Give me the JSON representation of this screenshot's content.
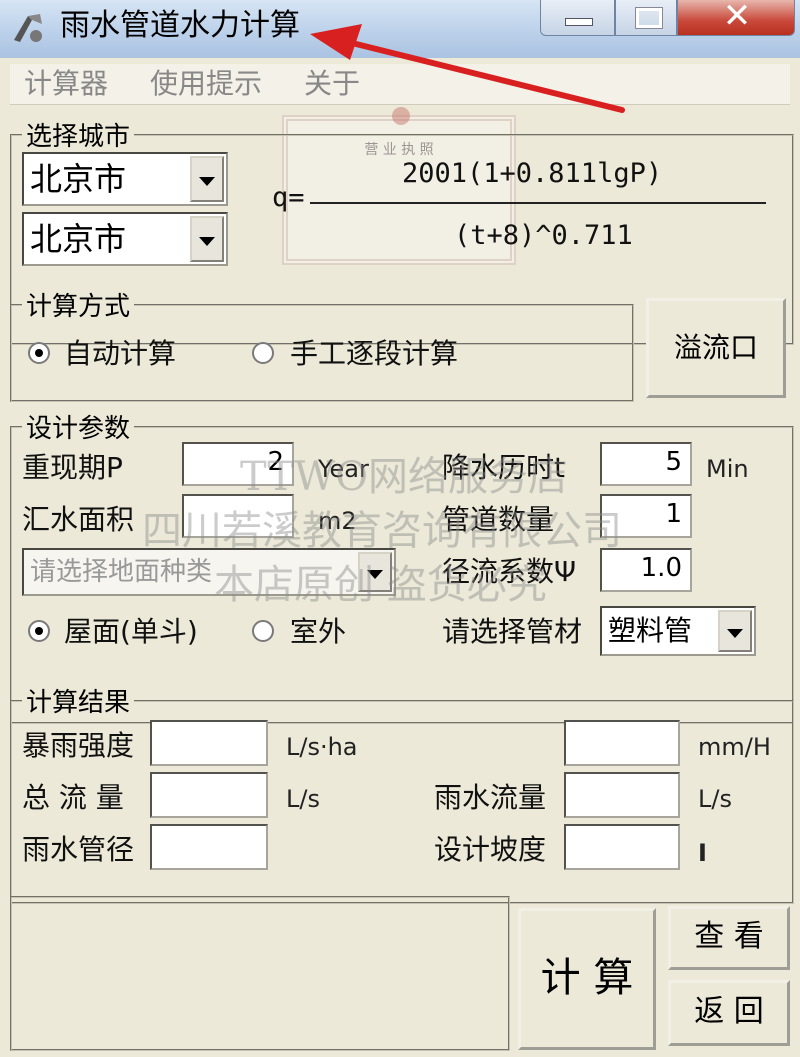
{
  "window": {
    "title": "雨水管道水力计算"
  },
  "menu": [
    "计算器",
    "使用提示",
    "关于"
  ],
  "city": {
    "legend": "选择城市",
    "province": "北京市",
    "city": "北京市"
  },
  "formula": {
    "prefix": "q=",
    "numerator": "2001(1+0.811lgP)",
    "denominator": "(t+8)^0.711"
  },
  "method": {
    "legend": "计算方式",
    "auto_label": "自动计算",
    "manual_label": "手工逐段计算",
    "overflow_button": "溢流口",
    "selected": "auto"
  },
  "params": {
    "legend": "设计参数",
    "return_period_label": "重现期P",
    "return_period_value": "2",
    "return_period_unit": "Year",
    "rain_duration_label": "降水历时t",
    "rain_duration_value": "5",
    "rain_duration_unit": "Min",
    "catch_area_label": "汇水面积",
    "catch_area_value": "",
    "catch_area_unit": "m2",
    "pipe_count_label": "管道数量",
    "pipe_count_value": "1",
    "surface_placeholder": "请选择地面种类",
    "runoff_label": "径流系数Ψ",
    "runoff_value": "1.0",
    "roof_label": "屋面(单斗)",
    "outdoor_label": "室外",
    "selected": "roof",
    "pipe_material_label": "请选择管材",
    "pipe_material_value": "塑料管"
  },
  "results": {
    "legend": "计算结果",
    "intensity_label": "暴雨强度",
    "intensity_unit1": "L/s·ha",
    "intensity_unit2": "mm/H",
    "total_flow_label": "总 流 量",
    "total_flow_unit": "L/s",
    "rain_flow_label": "雨水流量",
    "rain_flow_unit": "L/s",
    "pipe_diameter_label": "雨水管径",
    "slope_label": "设计坡度",
    "slope_unit": "I"
  },
  "buttons": {
    "calc": "计 算",
    "view": "查 看",
    "back": "返 回"
  },
  "overlay": {
    "license_title": "营 业 执 照",
    "watermark_line1": "TTWO网络服务店",
    "watermark_line2": "四川若溪教育咨询有限公司",
    "watermark_line3": "本店原创 盗货必究"
  },
  "colors": {
    "window_bg": "#ece9d8",
    "titlebar": "#bcd1ea",
    "close_button": "#c8483a",
    "annotation_arrow": "#d92020"
  }
}
